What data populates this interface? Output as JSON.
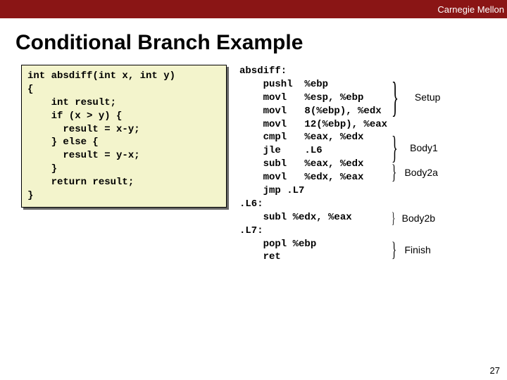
{
  "banner": {
    "label": "Carnegie Mellon"
  },
  "title": "Conditional Branch Example",
  "c_code": "int absdiff(int x, int y)\n{\n    int result;\n    if (x > y) {\n      result = x-y;\n    } else {\n      result = y-x;\n    }\n    return result;\n}",
  "asm_code": "absdiff:\n    pushl  %ebp\n    movl   %esp, %ebp\n    movl   8(%ebp), %edx\n    movl   12(%ebp), %eax\n    cmpl   %eax, %edx\n    jle    .L6\n    subl   %eax, %edx\n    movl   %edx, %eax\n    jmp .L7\n.L6:\n    subl %edx, %eax\n.L7:\n    popl %ebp\n    ret",
  "annotations": {
    "a0": "Setup",
    "a1": "Body1",
    "a2": "Body2a",
    "a3": "Body2b",
    "a4": "Finish"
  },
  "page_number": "27"
}
